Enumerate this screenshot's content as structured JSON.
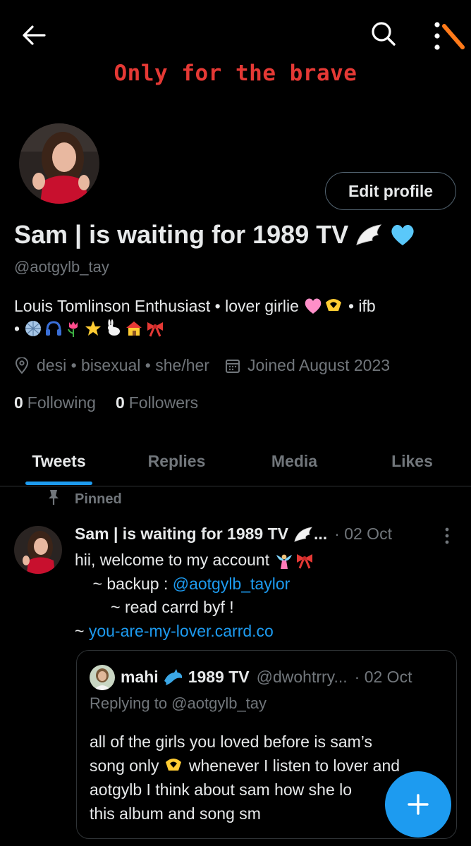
{
  "banner": {
    "text": "Only for the brave"
  },
  "profile": {
    "edit_label": "Edit profile",
    "name": "Sam | is waiting for 1989 TV",
    "handle": "@aotgylb_tay",
    "bio_line1": "Louis Tomlinson Enthusiast • lover girlie",
    "bio_line1_tail": "• ifb",
    "bio_line2_prefix": "•",
    "location": "desi • bisexual • she/her",
    "joined": "Joined August 2023",
    "following_count": "0",
    "following_label": "Following",
    "followers_count": "0",
    "followers_label": "Followers"
  },
  "tabs": [
    {
      "label": "Tweets"
    },
    {
      "label": "Replies"
    },
    {
      "label": "Media"
    },
    {
      "label": "Likes"
    }
  ],
  "tweet": {
    "pinned_label": "Pinned",
    "name": "Sam | is waiting for 1989 TV",
    "name_ellipsis": "...",
    "date": "· 02 Oct",
    "line1": "hii, welcome to my account",
    "line2_prefix": "    ~ backup : ",
    "line2_link": "@aotgylb_taylor",
    "line3": "        ~ read carrd byf !",
    "line4_prefix": "~ ",
    "line4_link": "you-are-my-lover.carrd.co",
    "quote": {
      "name": "mahi",
      "name_suffix": "1989 TV",
      "handle": "@dwohtrry...",
      "date": "· 02 Oct",
      "replying_to": "Replying to @aotgylb_tay",
      "line1": "all of the girls you loved before is sam’s",
      "line2_a": "song only",
      "line2_b": " whenever I listen to lover and",
      "line3": "aotgylb I think about sam how she lo",
      "line4": "this album and song sm"
    }
  },
  "colors": {
    "accent": "#1d9bf0",
    "banner_text": "#e53935",
    "muted": "#71767b",
    "text": "#e7e9ea",
    "border": "#2f3336"
  }
}
